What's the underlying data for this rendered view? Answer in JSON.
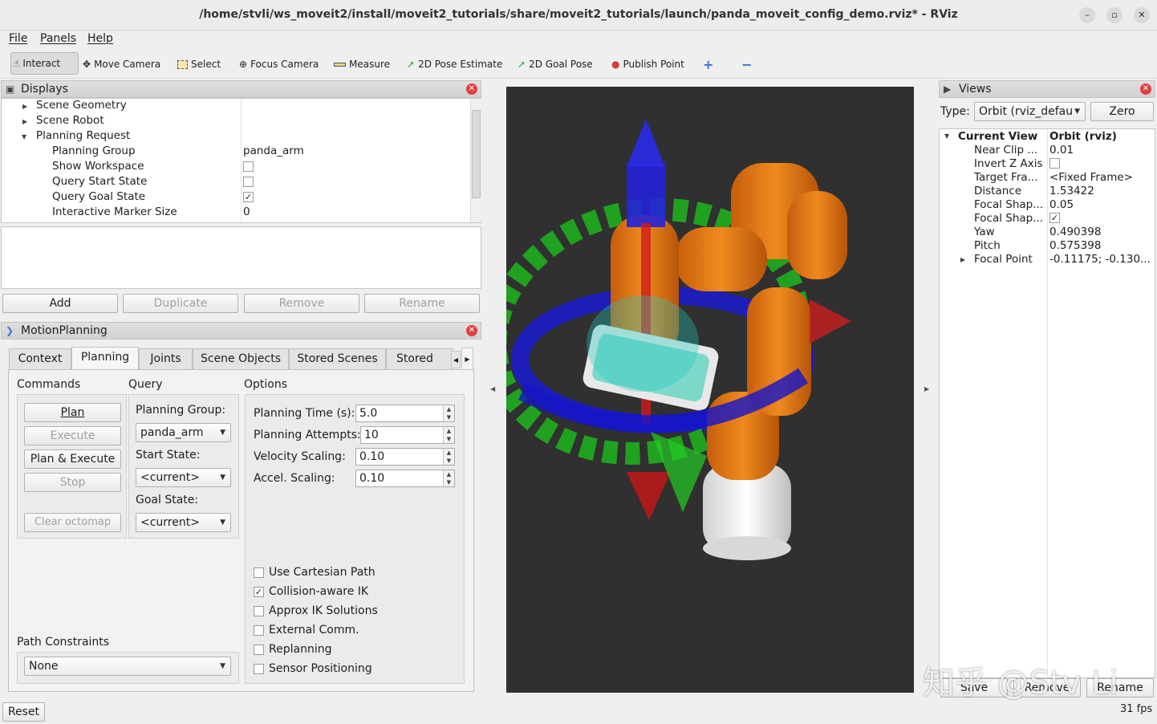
{
  "window": {
    "title": "/home/stvli/ws_moveit2/install/moveit2_tutorials/share/moveit2_tutorials/launch/panda_moveit_config_demo.rviz* - RViz"
  },
  "menu": {
    "file": "File",
    "panels": "Panels",
    "help": "Help"
  },
  "toolbar": {
    "interact": "Interact",
    "move_camera": "Move Camera",
    "select": "Select",
    "focus_camera": "Focus Camera",
    "measure": "Measure",
    "pose_estimate": "2D Pose Estimate",
    "goal_pose": "2D Goal Pose",
    "publish_point": "Publish Point"
  },
  "displays": {
    "title": "Displays",
    "items": [
      {
        "label": "Scene Geometry",
        "value": ""
      },
      {
        "label": "Scene Robot",
        "value": ""
      },
      {
        "label": "Planning Request",
        "value": ""
      },
      {
        "label": "Planning Group",
        "value": "panda_arm"
      },
      {
        "label": "Show Workspace",
        "value": ""
      },
      {
        "label": "Query Start State",
        "value": ""
      },
      {
        "label": "Query Goal State",
        "value": "✓"
      },
      {
        "label": "Interactive Marker Size",
        "value": "0"
      }
    ],
    "buttons": {
      "add": "Add",
      "duplicate": "Duplicate",
      "remove": "Remove",
      "rename": "Rename"
    }
  },
  "motion": {
    "title": "MotionPlanning",
    "tabs": [
      "Context",
      "Planning",
      "Joints",
      "Scene Objects",
      "Stored Scenes",
      "Stored Sta"
    ],
    "commands": {
      "label": "Commands",
      "plan": "Plan",
      "execute": "Execute",
      "plan_execute": "Plan & Execute",
      "stop": "Stop",
      "clear_octomap": "Clear octomap"
    },
    "query": {
      "label": "Query",
      "planning_group_label": "Planning Group:",
      "planning_group": "panda_arm",
      "start_state_label": "Start State:",
      "start_state": "<current>",
      "goal_state_label": "Goal State:",
      "goal_state": "<current>"
    },
    "options": {
      "label": "Options",
      "planning_time_label": "Planning Time (s):",
      "planning_time": "5.0",
      "planning_attempts_label": "Planning Attempts:",
      "planning_attempts": "10",
      "velocity_label": "Velocity Scaling:",
      "velocity": "0.10",
      "accel_label": "Accel. Scaling:",
      "accel": "0.10",
      "checks": [
        {
          "label": "Use Cartesian Path",
          "mark": ""
        },
        {
          "label": "Collision-aware IK",
          "mark": "✓"
        },
        {
          "label": "Approx IK Solutions",
          "mark": ""
        },
        {
          "label": "External Comm.",
          "mark": ""
        },
        {
          "label": "Replanning",
          "mark": ""
        },
        {
          "label": "Sensor Positioning",
          "mark": ""
        }
      ]
    },
    "path_constraints": {
      "label": "Path Constraints",
      "value": "None"
    }
  },
  "views": {
    "title": "Views",
    "type_label": "Type:",
    "type_value": "Orbit (rviz_defau",
    "zero": "Zero",
    "rows": [
      {
        "label": "Current View",
        "value": "Orbit (rviz)"
      },
      {
        "label": "Near Clip ...",
        "value": "0.01"
      },
      {
        "label": "Invert Z Axis",
        "value": ""
      },
      {
        "label": "Target Fra...",
        "value": "<Fixed Frame>"
      },
      {
        "label": "Distance",
        "value": "1.53422"
      },
      {
        "label": "Focal Shap...",
        "value": "0.05"
      },
      {
        "label": "Focal Shap...",
        "value": "✓"
      },
      {
        "label": "Yaw",
        "value": "0.490398"
      },
      {
        "label": "Pitch",
        "value": "0.575398"
      },
      {
        "label": "Focal Point",
        "value": "-0.11175; -0.130..."
      }
    ],
    "buttons": {
      "save": "Save",
      "remove": "Remove",
      "rename": "Rename"
    }
  },
  "status": {
    "reset": "Reset",
    "fps": "31 fps"
  },
  "watermark": "知乎 @Stv Li",
  "colors": {
    "accent_orange": "#e57a18",
    "viewport_bg": "#303030",
    "close_red": "#e04040"
  }
}
